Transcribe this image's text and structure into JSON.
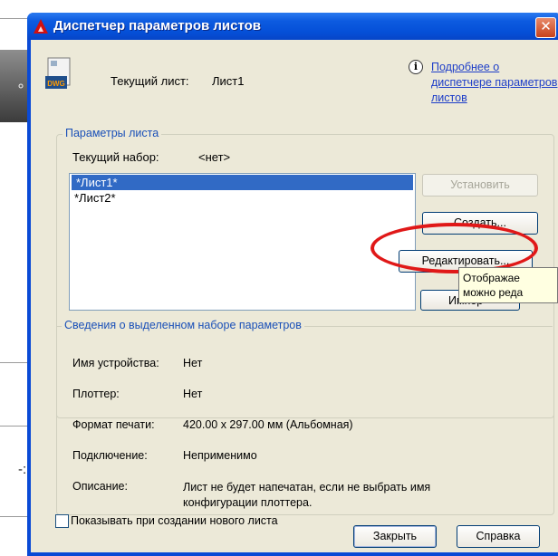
{
  "window": {
    "title": "Диспетчер параметров листов",
    "close_glyph": "✕"
  },
  "header": {
    "icon_text": "DWG",
    "current_sheet_label": "Текущий лист:",
    "current_sheet_value": "Лист1",
    "help_link": "Подробнее о диспетчере параметров листов"
  },
  "page_setups": {
    "legend": "Параметры листа",
    "current_set_label": "Текущий набор:",
    "current_set_value": "<нет>",
    "items": [
      {
        "label": "*Лист1*",
        "selected": true
      },
      {
        "label": "*Лист2*",
        "selected": false
      }
    ],
    "buttons": {
      "set": "Установить",
      "create": "Создать...",
      "edit": "Редактировать...",
      "import": "Импор"
    },
    "tooltip_lines": [
      "Отображае",
      "можно реда"
    ]
  },
  "details": {
    "legend": "Сведения о выделенном наборе параметров",
    "rows": [
      {
        "label": "Имя устройства:",
        "value": "Нет"
      },
      {
        "label": "Плоттер:",
        "value": "Нет"
      },
      {
        "label": "Формат печати:",
        "value": "420.00 x 297.00 мм (Альбомная)"
      },
      {
        "label": "Подключение:",
        "value": "Неприменимо"
      },
      {
        "label": "Описание:",
        "value": "Лист не будет напечатан, если не выбрать имя конфигурации плоттера."
      }
    ]
  },
  "footer": {
    "checkbox_label": "Показывать при создании нового листа",
    "checkbox_checked": false,
    "close": "Закрыть",
    "help": "Справка"
  },
  "colors": {
    "titlebar": "#0550d8",
    "dialog_bg": "#ece9d8",
    "legend_text": "#1a50b8",
    "selection": "#316ac5",
    "highlight_oval": "#e01818"
  }
}
